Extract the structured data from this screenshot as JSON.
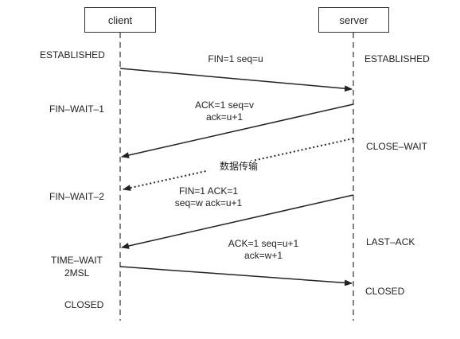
{
  "participants": {
    "client": "client",
    "server": "server"
  },
  "client_states": [
    "ESTABLISHED",
    "FIN–WAIT–1",
    "FIN–WAIT–2",
    "TIME–WAIT",
    "2MSL",
    "CLOSED"
  ],
  "server_states": [
    "ESTABLISHED",
    "CLOSE–WAIT",
    "LAST–ACK",
    "CLOSED"
  ],
  "messages": [
    {
      "line1": "FIN=1 seq=u",
      "line2": ""
    },
    {
      "line1": "ACK=1 seq=v",
      "line2": "ack=u+1"
    },
    {
      "line1": "数据传输",
      "line2": ""
    },
    {
      "line1": "FIN=1 ACK=1",
      "line2": "seq=w ack=u+1"
    },
    {
      "line1": "ACK=1 seq=u+1",
      "line2": "ack=w+1"
    }
  ]
}
